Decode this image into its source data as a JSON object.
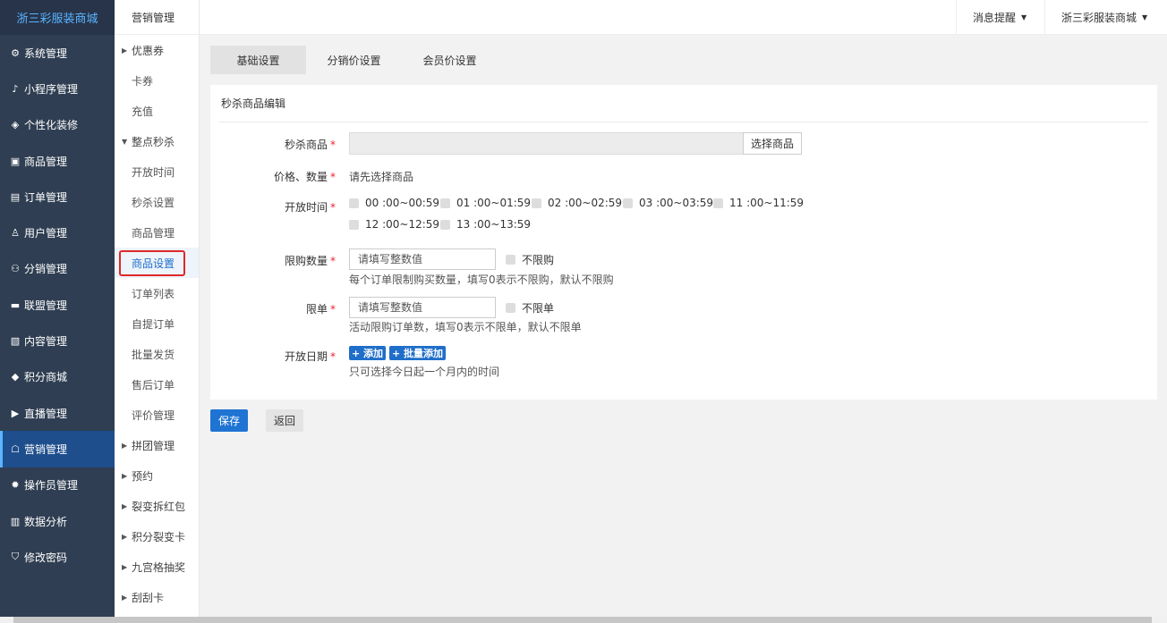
{
  "brand": "浙三彩服装商城",
  "sidebar": {
    "items": [
      {
        "icon": "gear-icon",
        "glyph": "⚙",
        "label": "系统管理"
      },
      {
        "icon": "miniapp-icon",
        "glyph": "♪",
        "label": "小程序管理"
      },
      {
        "icon": "decor-icon",
        "glyph": "◈",
        "label": "个性化装修"
      },
      {
        "icon": "bag-icon",
        "glyph": "▣",
        "label": "商品管理"
      },
      {
        "icon": "order-icon",
        "glyph": "▤",
        "label": "订单管理"
      },
      {
        "icon": "user-icon",
        "glyph": "♙",
        "label": "用户管理"
      },
      {
        "icon": "distribution-icon",
        "glyph": "⚇",
        "label": "分销管理"
      },
      {
        "icon": "alliance-icon",
        "glyph": "▬",
        "label": "联盟管理"
      },
      {
        "icon": "content-icon",
        "glyph": "▧",
        "label": "内容管理"
      },
      {
        "icon": "points-icon",
        "glyph": "◆",
        "label": "积分商城"
      },
      {
        "icon": "play-icon",
        "glyph": "▶",
        "label": "直播管理"
      },
      {
        "icon": "marketing-icon",
        "glyph": "☖",
        "label": "营销管理"
      },
      {
        "icon": "operator-icon",
        "glyph": "✹",
        "label": "操作员管理"
      },
      {
        "icon": "chart-icon",
        "glyph": "▥",
        "label": "数据分析"
      },
      {
        "icon": "shield-icon",
        "glyph": "⛉",
        "label": "修改密码"
      }
    ]
  },
  "subnav": {
    "title": "营销管理",
    "items": [
      {
        "type": "group",
        "label": "优惠券"
      },
      {
        "type": "item",
        "label": "卡券"
      },
      {
        "type": "item",
        "label": "充值"
      },
      {
        "type": "group-open",
        "label": "整点秒杀"
      },
      {
        "type": "item",
        "label": "开放时间"
      },
      {
        "type": "item",
        "label": "秒杀设置"
      },
      {
        "type": "item",
        "label": "商品管理"
      },
      {
        "type": "item",
        "label": "商品设置"
      },
      {
        "type": "item",
        "label": "订单列表"
      },
      {
        "type": "item",
        "label": "自提订单"
      },
      {
        "type": "item",
        "label": "批量发货"
      },
      {
        "type": "item",
        "label": "售后订单"
      },
      {
        "type": "item",
        "label": "评价管理"
      },
      {
        "type": "group",
        "label": "拼团管理"
      },
      {
        "type": "group",
        "label": "预约"
      },
      {
        "type": "group",
        "label": "裂变拆红包"
      },
      {
        "type": "group",
        "label": "积分裂变卡"
      },
      {
        "type": "group",
        "label": "九宫格抽奖"
      },
      {
        "type": "group",
        "label": "刮刮卡"
      }
    ]
  },
  "topbar": {
    "notify": "消息提醒",
    "account": "浙三彩服装商城"
  },
  "tabs": [
    "基础设置",
    "分销价设置",
    "会员价设置"
  ],
  "panel": {
    "title": "秒杀商品编辑",
    "goods_label": "秒杀商品",
    "pick_button": "选择商品",
    "price_label": "价格、数量",
    "price_value": "请先选择商品",
    "time_label": "开放时间",
    "time_slots": [
      "00 :00~00:59",
      "01 :00~01:59",
      "02 :00~02:59",
      "03 :00~03:59",
      "11 :00~11:59",
      "12 :00~12:59",
      "13 :00~13:59"
    ],
    "limit_label": "限购数量",
    "limit_placeholder": "请填写整数值",
    "limit_check": "不限购",
    "limit_hint": "每个订单限制购买数量，填写0表示不限购，默认不限购",
    "order_label": "限单",
    "order_placeholder": "请填写整数值",
    "order_check": "不限单",
    "order_hint": "活动限购订单数，填写0表示不限单，默认不限单",
    "date_label": "开放日期",
    "add_button": "+ 添加",
    "batch_button": "+ 批量添加",
    "date_hint": "只可选择今日起一个月内的时间"
  },
  "actions": {
    "save": "保存",
    "back": "返回"
  },
  "colors": {
    "sidebar": "#2f3e52",
    "primary": "#1f6ec9",
    "active_outline": "#e02828"
  }
}
